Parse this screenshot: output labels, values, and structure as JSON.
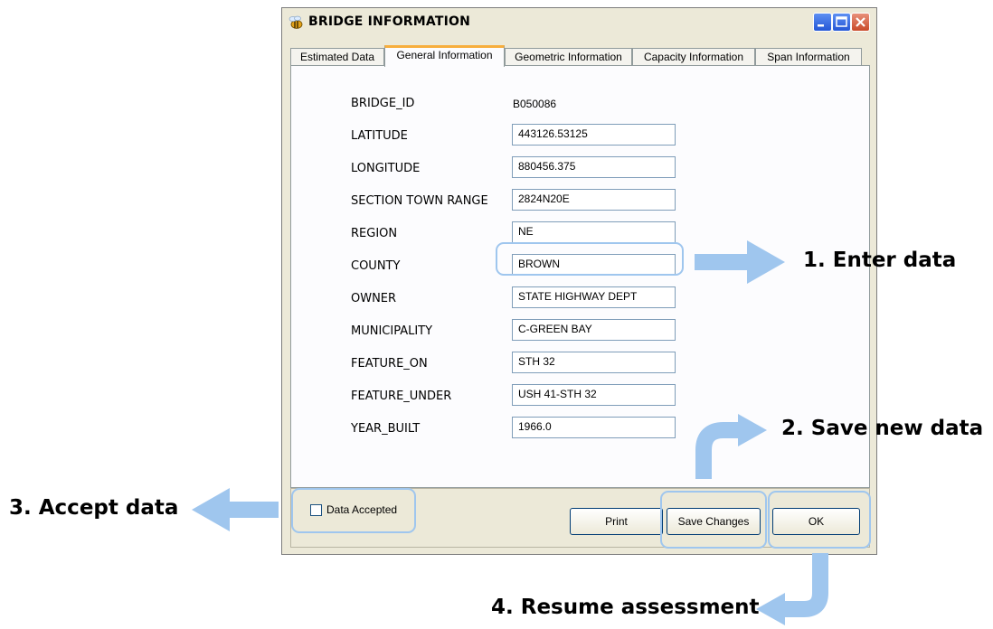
{
  "window": {
    "title": "BRIDGE INFORMATION"
  },
  "tabs": [
    {
      "label": "Estimated Data"
    },
    {
      "label": "General Information"
    },
    {
      "label": "Geometric Information"
    },
    {
      "label": "Capacity Information"
    },
    {
      "label": "Span Information"
    }
  ],
  "active_tab": "General Information",
  "fields": {
    "bridge_id": {
      "label": "BRIDGE_ID",
      "value": "B050086"
    },
    "latitude": {
      "label": "LATITUDE",
      "value": "443126.53125"
    },
    "longitude": {
      "label": "LONGITUDE",
      "value": "880456.375"
    },
    "section_town_range": {
      "label": "SECTION TOWN RANGE",
      "value": "2824N20E"
    },
    "region": {
      "label": "REGION",
      "value": "NE"
    },
    "county": {
      "label": "COUNTY",
      "value": "BROWN"
    },
    "owner": {
      "label": "OWNER",
      "value": "STATE HIGHWAY DEPT"
    },
    "municipality": {
      "label": "MUNICIPALITY",
      "value": "C-GREEN BAY"
    },
    "feature_on": {
      "label": "FEATURE_ON",
      "value": "STH 32"
    },
    "feature_under": {
      "label": "FEATURE_UNDER",
      "value": "USH 41-STH 32"
    },
    "year_built": {
      "label": "YEAR_BUILT",
      "value": "1966.0"
    }
  },
  "bottom": {
    "checkbox_label": "Data Accepted",
    "checkbox_checked": false,
    "print_label": "Print",
    "save_label": "Save Changes",
    "ok_label": "OK"
  },
  "annotations": {
    "step1": "1. Enter data",
    "step2": "2. Save new data",
    "step3": "3. Accept data",
    "step4": "4. Resume assessment"
  },
  "colors": {
    "window_bg": "#ECE9D8",
    "annotation_arrow": "#9fc6ee",
    "active_tab_accent": "#f7ae3d",
    "close_button": "#c94a2a"
  },
  "icons": {
    "app": "bee-icon",
    "minimize": "minimize-icon",
    "maximize": "maximize-icon",
    "close": "close-icon"
  }
}
